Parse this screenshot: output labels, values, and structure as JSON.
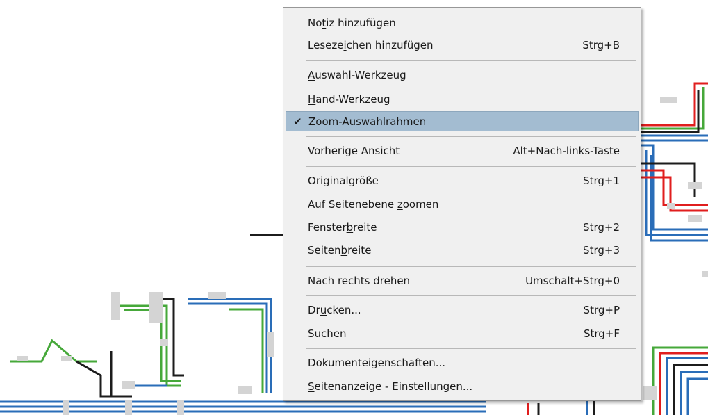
{
  "menu": {
    "items": [
      {
        "id": "notiz",
        "pre": "No",
        "acc": "t",
        "post": "iz hinzufügen",
        "shortcut": "",
        "checked": false,
        "highlighted": false
      },
      {
        "id": "lesezeichen",
        "pre": "Leseze",
        "acc": "i",
        "post": "chen hinzufügen",
        "shortcut": "Strg+B",
        "checked": false,
        "highlighted": false
      },
      {
        "id": "auswahl",
        "pre": "",
        "acc": "A",
        "post": "uswahl-Werkzeug",
        "shortcut": "",
        "checked": false,
        "highlighted": false
      },
      {
        "id": "hand",
        "pre": "",
        "acc": "H",
        "post": "and-Werkzeug",
        "shortcut": "",
        "checked": false,
        "highlighted": false
      },
      {
        "id": "zoomrahmen",
        "pre": "",
        "acc": "Z",
        "post": "oom-Auswahlrahmen",
        "shortcut": "",
        "checked": true,
        "highlighted": true
      },
      {
        "id": "vorherige",
        "pre": "V",
        "acc": "o",
        "post": "rherige Ansicht",
        "shortcut": "Alt+Nach-links-Taste",
        "checked": false,
        "highlighted": false
      },
      {
        "id": "original",
        "pre": "",
        "acc": "O",
        "post": "riginalgröße",
        "shortcut": "Strg+1",
        "checked": false,
        "highlighted": false
      },
      {
        "id": "seitenebene",
        "pre": "Auf Seitenebene ",
        "acc": "z",
        "post": "oomen",
        "shortcut": "",
        "checked": false,
        "highlighted": false
      },
      {
        "id": "fensterbreite",
        "pre": "Fenster",
        "acc": "b",
        "post": "reite",
        "shortcut": "Strg+2",
        "checked": false,
        "highlighted": false
      },
      {
        "id": "seitenbreite",
        "pre": "Seiten",
        "acc": "b",
        "post": "reite",
        "shortcut": "Strg+3",
        "checked": false,
        "highlighted": false
      },
      {
        "id": "drehen",
        "pre": "Nach ",
        "acc": "r",
        "post": "echts drehen",
        "shortcut": "Umschalt+Strg+0",
        "checked": false,
        "highlighted": false
      },
      {
        "id": "drucken",
        "pre": "Dr",
        "acc": "u",
        "post": "cken...",
        "shortcut": "Strg+P",
        "checked": false,
        "highlighted": false
      },
      {
        "id": "suchen",
        "pre": "",
        "acc": "S",
        "post": "uchen",
        "shortcut": "Strg+F",
        "checked": false,
        "highlighted": false
      },
      {
        "id": "eigenschaften",
        "pre": "",
        "acc": "D",
        "post": "okumenteigenschaften...",
        "shortcut": "",
        "checked": false,
        "highlighted": false
      },
      {
        "id": "seitenanzeige",
        "pre": "",
        "acc": "S",
        "post": "eitenanzeige - Einstellungen...",
        "shortcut": "",
        "checked": false,
        "highlighted": false
      }
    ],
    "checkmark_glyph": "✔",
    "colors": {
      "highlight": "#a3bcd1",
      "menu_bg": "#f0f0f0"
    }
  },
  "diagram": {
    "colors": {
      "blue": "#2a6db8",
      "green": "#46a83a",
      "red": "#e01e1e",
      "black": "#1c1c1c",
      "gray": "#cfcfcf"
    }
  }
}
